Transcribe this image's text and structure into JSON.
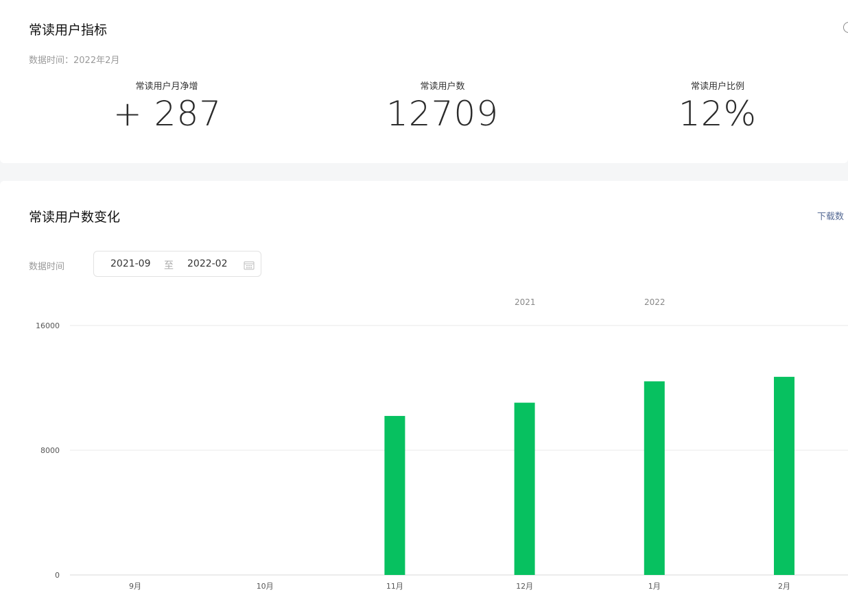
{
  "summary": {
    "title": "常读用户指标",
    "data_time": "数据时间：2022年2月",
    "metrics": [
      {
        "label": "常读用户月净增",
        "value": "+ 287"
      },
      {
        "label": "常读用户数",
        "value": "12709"
      },
      {
        "label": "常读用户比例",
        "value": "12%"
      }
    ]
  },
  "trend": {
    "title": "常读用户数变化",
    "download_label": "下载数",
    "data_time_label": "数据时间",
    "date_start": "2021-09",
    "date_separator": "至",
    "date_end": "2022-02",
    "year_labels": [
      "2021",
      "2022"
    ]
  },
  "chart_data": {
    "type": "bar",
    "categories": [
      "9月",
      "10月",
      "11月",
      "12月",
      "1月",
      "2月"
    ],
    "values": [
      0,
      0,
      10200,
      11050,
      12420,
      12709
    ],
    "ylim": [
      0,
      16000
    ],
    "yticks": [
      "0",
      "8000",
      "16000"
    ],
    "grid": true,
    "bar_color": "#07c160",
    "xlabel": "",
    "ylabel": ""
  }
}
